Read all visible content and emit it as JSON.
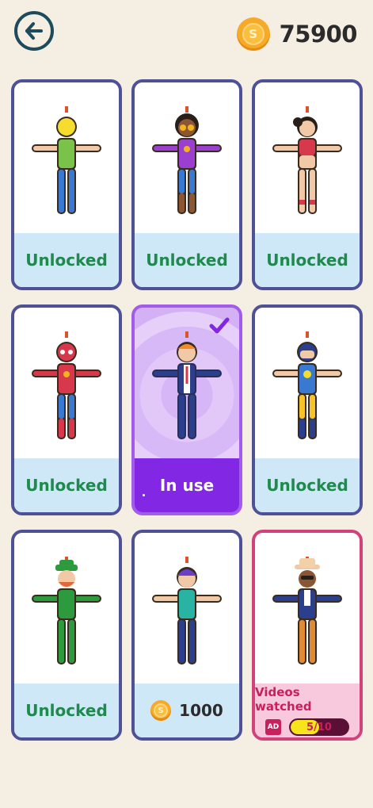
{
  "header": {
    "coins": "75900",
    "coin_symbol": "S"
  },
  "cards": [
    {
      "status": "Unlocked",
      "skin": "yellow-green"
    },
    {
      "status": "Unlocked",
      "skin": "rich"
    },
    {
      "status": "Unlocked",
      "skin": "girl"
    },
    {
      "status": "Unlocked",
      "skin": "spider"
    },
    {
      "status": "In use",
      "skin": "office"
    },
    {
      "status": "Unlocked",
      "skin": "super"
    },
    {
      "status": "Unlocked",
      "skin": "leprechaun"
    },
    {
      "price": "1000",
      "skin": "purple-hair"
    },
    {
      "ad_label": "Videos watched",
      "ad_badge": "AD",
      "ad_progress": "5/10",
      "ad_fraction": 0.5,
      "skin": "hat"
    }
  ]
}
